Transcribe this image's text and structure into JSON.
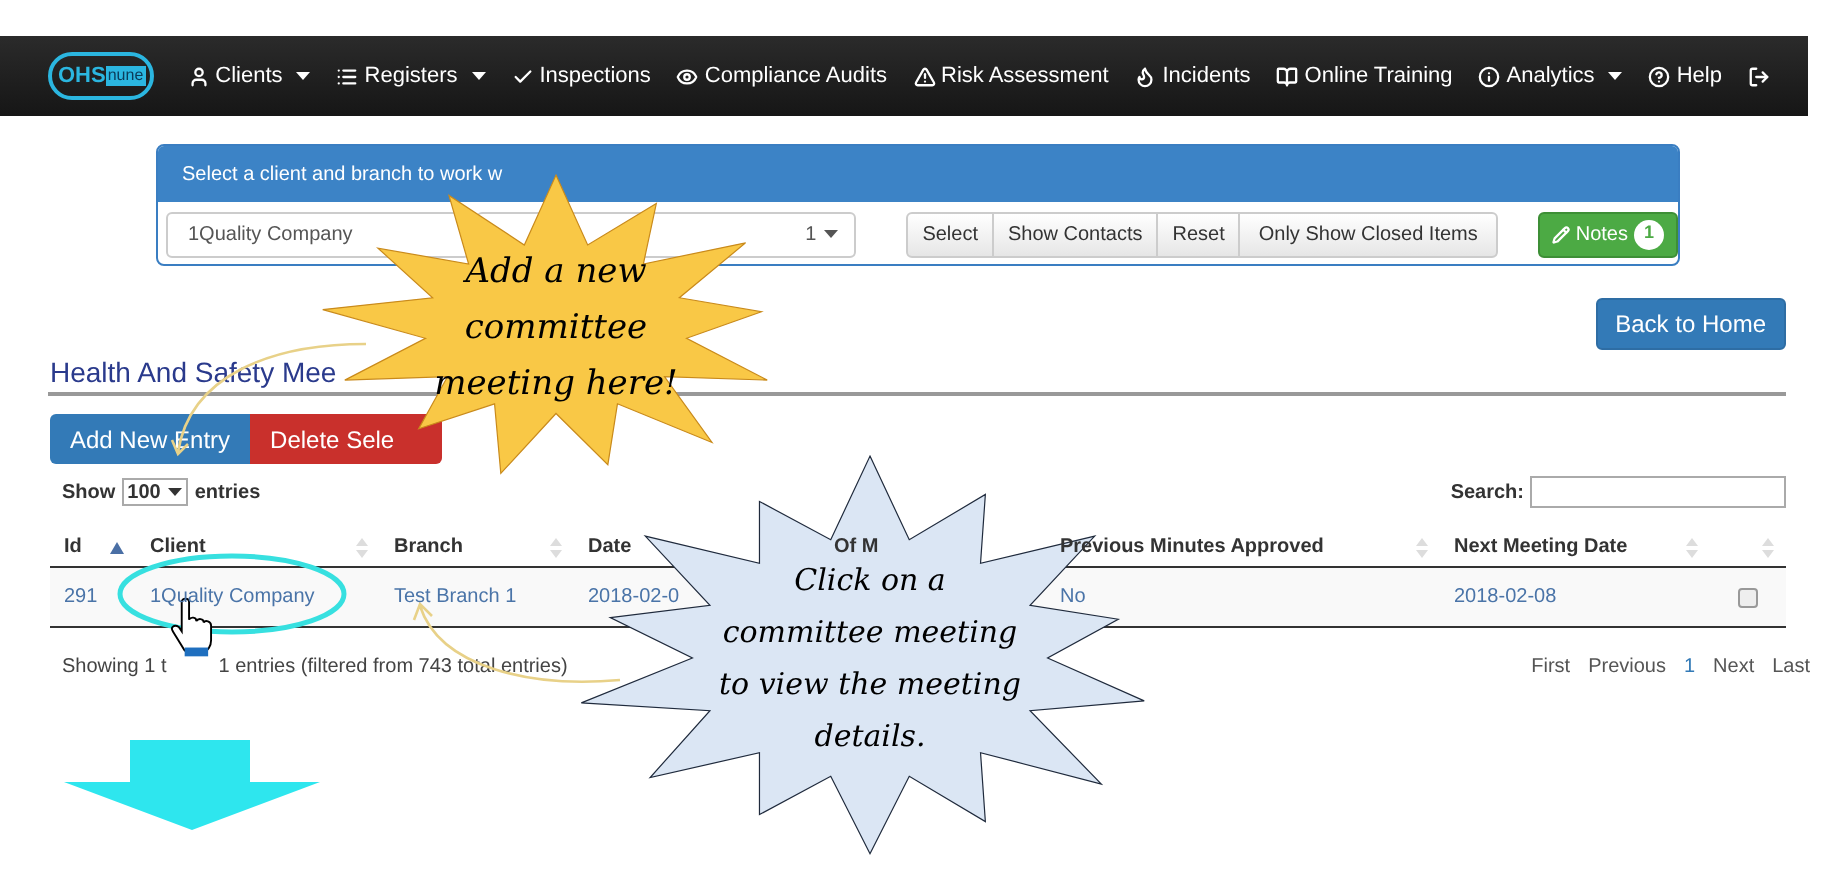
{
  "navbar": {
    "logo": {
      "text_1": "OHS",
      "text_2": "nune"
    },
    "items": [
      {
        "label": "Clients",
        "dropdown": true
      },
      {
        "label": "Registers",
        "dropdown": true
      },
      {
        "label": "Inspections",
        "dropdown": false
      },
      {
        "label": "Compliance Audits",
        "dropdown": false
      },
      {
        "label": "Risk Assessment",
        "dropdown": false
      },
      {
        "label": "Incidents",
        "dropdown": false
      },
      {
        "label": "Online Training",
        "dropdown": false
      },
      {
        "label": "Analytics",
        "dropdown": true
      },
      {
        "label": "Help",
        "dropdown": false
      }
    ]
  },
  "client_panel": {
    "heading": "Select a client and branch to work w",
    "client_value": "1Quality Company",
    "branch_value": "1",
    "buttons": [
      "Select",
      "Show Contacts",
      "Reset",
      "Only Show Closed Items"
    ],
    "notes": {
      "label": "Notes",
      "count": "1"
    }
  },
  "back_button": "Back to Home",
  "page_title": "Health And Safety Mee",
  "actions": {
    "add": "Add New Entry",
    "delete": "Delete Sele"
  },
  "length": {
    "prefix": "Show",
    "value": "100",
    "suffix": "entries"
  },
  "search": {
    "label": "Search:"
  },
  "table": {
    "columns": [
      {
        "label": "Id",
        "sorted": true
      },
      {
        "label": "Client",
        "sorted": false
      },
      {
        "label": "Branch",
        "sorted": false
      },
      {
        "label": "Date"
      },
      {
        "label": "Of M"
      },
      {
        "label": "Previous Minutes Approved",
        "sorted": false
      },
      {
        "label": "Next Meeting Date",
        "sorted": false
      },
      {
        "sorted": false
      }
    ],
    "rows": [
      {
        "cells": [
          "291",
          "1Quality Company",
          "Test Branch 1",
          "2018-02-0",
          "",
          "No",
          "2018-02-08"
        ],
        "checked": false
      }
    ]
  },
  "info": {
    "part_1": "Showing 1 t",
    "part_2": "1 entries (filtered from 743 total entries)"
  },
  "pagination": [
    {
      "label": "First",
      "current": false
    },
    {
      "label": "Previous",
      "current": false
    },
    {
      "label": "1",
      "current": true
    },
    {
      "label": "Next",
      "current": false
    },
    {
      "label": "Last",
      "current": false
    }
  ],
  "callouts": [
    {
      "kind": "yellow",
      "lines": [
        "Add a new",
        "committee",
        "meeting here!"
      ]
    },
    {
      "kind": "blue",
      "lines": [
        "Click on a",
        "committee meeting",
        "to view the meeting",
        "details."
      ]
    }
  ]
}
